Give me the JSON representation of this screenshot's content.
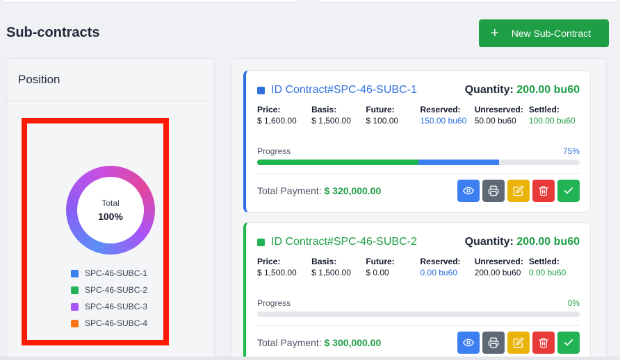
{
  "page": {
    "title": "Sub-contracts",
    "new_button_label": "New Sub-Contract",
    "new_button_icon": "plus-icon"
  },
  "position": {
    "title": "Position",
    "donut": {
      "center_label": "Total",
      "center_value": "100%"
    },
    "legend": [
      {
        "label": "SPC-46-SUBC-1",
        "color": "#3b7ff0"
      },
      {
        "label": "SPC-46-SUBC-2",
        "color": "#22b454"
      },
      {
        "label": "SPC-46-SUBC-3",
        "color": "#a855f7"
      },
      {
        "label": "SPC-46-SUBC-4",
        "color": "#f97316"
      }
    ]
  },
  "contracts": [
    {
      "id": "ID Contract#SPC-46-SUBC-1",
      "dot_color": "#2f6fe0",
      "quantity_label": "Quantity:",
      "quantity_value": "200.00 bu60",
      "fields": [
        {
          "label": "Price:",
          "value": "$ 1,600.00"
        },
        {
          "label": "Basis:",
          "value": "$ 1,500.00"
        },
        {
          "label": "Future:",
          "value": "$ 100.00"
        },
        {
          "label": "Reserved:",
          "value": "150.00 bu60"
        },
        {
          "label": "Unreserved:",
          "value": "50.00 bu60"
        },
        {
          "label": "Settled:",
          "value": "100.00 bu60"
        }
      ],
      "progress_label": "Progress",
      "progress_percent": "75%",
      "progress": {
        "settled_fraction": 0.5,
        "reserved_fraction": 0.25
      },
      "payment_label": "Total Payment:",
      "payment_value": "$ 320,000.00"
    },
    {
      "id": "ID Contract#SPC-46-SUBC-2",
      "dot_color": "#22b454",
      "quantity_label": "Quantity:",
      "quantity_value": "200.00 bu60",
      "fields": [
        {
          "label": "Price:",
          "value": "$ 1,500.00"
        },
        {
          "label": "Basis:",
          "value": "$ 1,500.00"
        },
        {
          "label": "Future:",
          "value": "$ 0.00"
        },
        {
          "label": "Reserved:",
          "value": "0.00 bu60"
        },
        {
          "label": "Unreserved:",
          "value": "200.00 bu60"
        },
        {
          "label": "Settled:",
          "value": "0.00 bu60"
        }
      ],
      "progress_label": "Progress",
      "progress_percent": "0%",
      "progress": {
        "settled_fraction": 0,
        "reserved_fraction": 0
      },
      "payment_label": "Total Payment:",
      "payment_value": "$ 300,000.00"
    }
  ],
  "actions": [
    "eye-icon",
    "printer-icon",
    "edit-icon",
    "trash-icon",
    "check-icon"
  ]
}
